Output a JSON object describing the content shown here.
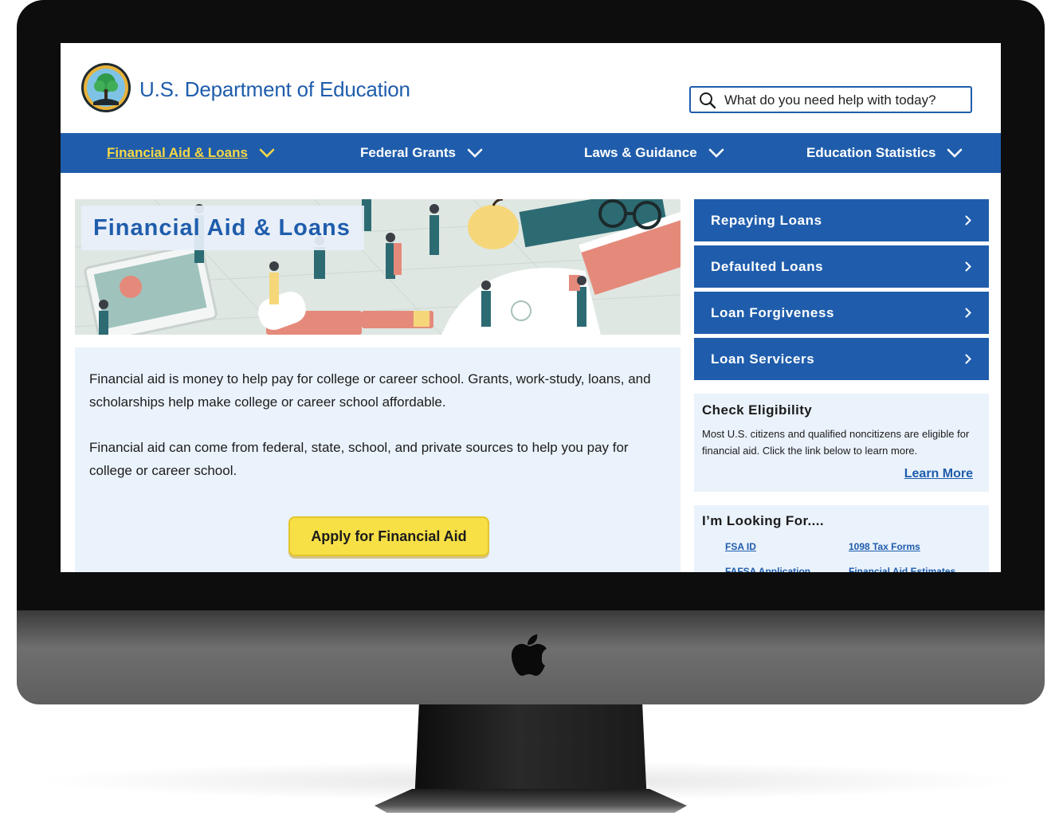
{
  "site": {
    "title": "U.S. Department of Education",
    "seal": "department-seal-tree"
  },
  "search": {
    "placeholder": "What do you need help with today?"
  },
  "nav": {
    "items": [
      {
        "label": "Financial Aid & Loans",
        "active": true
      },
      {
        "label": "Federal Grants",
        "active": false
      },
      {
        "label": "Laws & Guidance",
        "active": false
      },
      {
        "label": "Education Statistics",
        "active": false
      }
    ]
  },
  "hero": {
    "title": "Financial Aid & Loans",
    "illustration": "students-on-books-and-tablet-illustration"
  },
  "intro": {
    "paragraph1": "Financial aid is money to help pay for college or career school. Grants, work-study, loans, and scholarships help make college or career school affordable.",
    "paragraph2": "Financial aid can come from federal, state, school, and private sources to help you pay for college or career school.",
    "apply_button": "Apply for Financial Aid"
  },
  "sidebar": {
    "links": [
      {
        "label": "Repaying Loans"
      },
      {
        "label": "Defaulted Loans"
      },
      {
        "label": "Loan Forgiveness"
      },
      {
        "label": "Loan Servicers"
      }
    ],
    "eligibility": {
      "title": "Check Eligibility",
      "text": "Most U.S. citizens and qualified noncitizens are eligible for financial aid. Click the link below to learn more.",
      "link": "Learn More"
    },
    "looking_for": {
      "title": "I’m Looking For....",
      "links": [
        "FSA ID",
        "1098 Tax Forms",
        "FAFSA Application",
        "Financial Aid Estimates"
      ]
    }
  },
  "colors": {
    "primary_blue": "#1f5dac",
    "active_nav_yellow": "#f6d844",
    "button_yellow": "#f7e046",
    "panel_light_blue": "#eaf2fb"
  },
  "device": {
    "logo": "apple-logo"
  }
}
